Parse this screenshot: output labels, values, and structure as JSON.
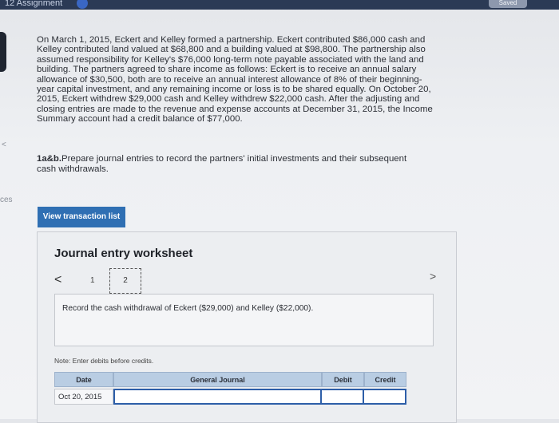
{
  "topbar": {
    "title": "12 Assignment",
    "right_label": "Saved"
  },
  "edge": {
    "arrow": "<",
    "label": "ces"
  },
  "problem": {
    "text": "On March 1, 2015, Eckert and Kelley formed a partnership. Eckert contributed $86,000 cash and Kelley contributed land valued at $68,800 and a building valued at $98,800. The partnership also assumed responsibility for Kelley's $76,000 long-term note payable associated with the land and building. The partners agreed to share income as follows: Eckert is to receive an annual salary allowance of $30,500, both are to receive an annual interest allowance of 8% of their beginning-year capital investment, and any remaining income or loss is to be shared equally. On October 20, 2015, Eckert withdrew $29,000 cash and Kelley withdrew $22,000 cash. After the adjusting and closing entries are made to the revenue and expense accounts at December 31, 2015, the Income Summary account had a credit balance of $77,000."
  },
  "instruction": {
    "number": "1a&b.",
    "text": "Prepare journal entries to record the partners' initial investments and their subsequent cash withdrawals."
  },
  "view_button": {
    "label": "View transaction list"
  },
  "worksheet": {
    "title": "Journal entry worksheet",
    "nav_prev": "<",
    "nav_next": ">",
    "pages": [
      "1",
      "2"
    ],
    "current_page": "2",
    "record_text": "Record the cash withdrawal of Eckert ($29,000) and Kelley ($22,000).",
    "note": "Note: Enter debits before credits."
  },
  "table": {
    "headers": {
      "date": "Date",
      "journal": "General Journal",
      "debit": "Debit",
      "credit": "Credit"
    },
    "rows": [
      {
        "date": "Oct 20, 2015",
        "journal": "",
        "debit": "",
        "credit": ""
      }
    ]
  },
  "colors": {
    "button": "#2f6fb3",
    "header": "#b9cde3",
    "input_border": "#2d5ea8"
  }
}
